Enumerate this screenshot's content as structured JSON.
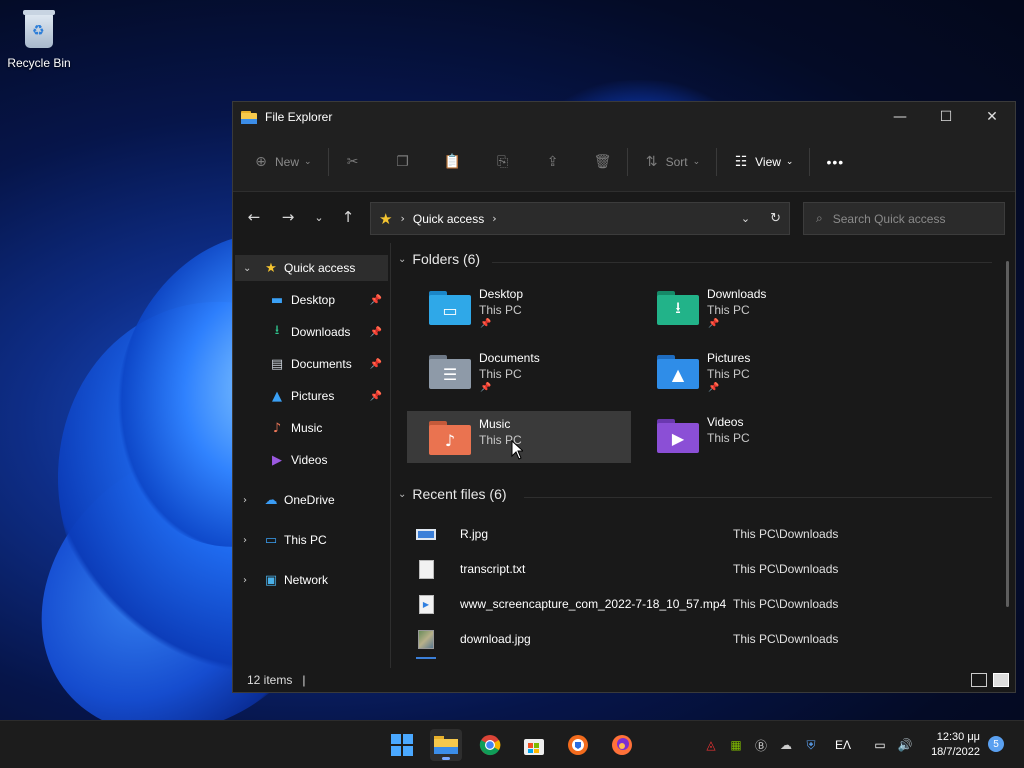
{
  "desktop": {
    "recycle_bin_label": "Recycle Bin"
  },
  "window": {
    "title": "File Explorer",
    "controls": {
      "minimize": "—",
      "maximize": "☐",
      "close": "✕"
    }
  },
  "toolbar": {
    "new_label": "New",
    "sort_label": "Sort",
    "view_label": "View",
    "more_glyph": "•••",
    "icons": [
      "cut-icon",
      "copy-icon",
      "paste-icon",
      "rename-icon",
      "share-icon",
      "delete-icon"
    ]
  },
  "address": {
    "crumb": "Quick access",
    "search_placeholder": "Search Quick access"
  },
  "sidebar": {
    "items": [
      {
        "label": "Quick access",
        "icon": "star-icon",
        "color": "#f4c430"
      },
      {
        "label": "Desktop",
        "icon": "desktop-icon",
        "color": "#3aa0f5",
        "pinned": true
      },
      {
        "label": "Downloads",
        "icon": "download-icon",
        "color": "#2fc48e",
        "pinned": true
      },
      {
        "label": "Documents",
        "icon": "document-icon",
        "color": "#c8ced6",
        "pinned": true
      },
      {
        "label": "Pictures",
        "icon": "picture-icon",
        "color": "#3aa0f5",
        "pinned": true
      },
      {
        "label": "Music",
        "icon": "music-icon",
        "color": "#f0795a"
      },
      {
        "label": "Videos",
        "icon": "video-icon",
        "color": "#9b59e0"
      },
      {
        "label": "OneDrive",
        "icon": "cloud-icon",
        "color": "#3a9cf5"
      },
      {
        "label": "This PC",
        "icon": "pc-icon",
        "color": "#3aa0f5"
      },
      {
        "label": "Network",
        "icon": "network-icon",
        "color": "#4ab0e8"
      }
    ]
  },
  "folders_section": {
    "title": "Folders (6)",
    "folders": [
      {
        "name": "Desktop",
        "location": "This PC",
        "pinned": true,
        "color": "#2fa8e8",
        "glyph": "▭"
      },
      {
        "name": "Downloads",
        "location": "This PC",
        "pinned": true,
        "color": "#22b389",
        "glyph": "⭳"
      },
      {
        "name": "Documents",
        "location": "This PC",
        "pinned": true,
        "color": "#8e9aa8",
        "glyph": "☰"
      },
      {
        "name": "Pictures",
        "location": "This PC",
        "pinned": true,
        "color": "#2f8de8",
        "glyph": "▲"
      },
      {
        "name": "Music",
        "location": "This PC",
        "pinned": false,
        "color": "#ea7350",
        "glyph": "♪"
      },
      {
        "name": "Videos",
        "location": "This PC",
        "pinned": false,
        "color": "#8b4fd6",
        "glyph": "▶"
      }
    ]
  },
  "recent_section": {
    "title": "Recent files (6)",
    "files": [
      {
        "name": "R.jpg",
        "location": "This PC\\Downloads",
        "icon": "image-file-icon"
      },
      {
        "name": "transcript.txt",
        "location": "This PC\\Downloads",
        "icon": "text-file-icon"
      },
      {
        "name": "www_screencapture_com_2022-7-18_10_57.mp4",
        "location": "This PC\\Downloads",
        "icon": "video-file-icon"
      },
      {
        "name": "download.jpg",
        "location": "This PC\\Downloads",
        "icon": "image-file-icon"
      }
    ]
  },
  "status": {
    "items": "12 items",
    "cursor": "|"
  },
  "taskbar": {
    "language": "ΕΛ",
    "time": "12:30 μμ",
    "date": "18/7/2022",
    "notifications": "5"
  }
}
